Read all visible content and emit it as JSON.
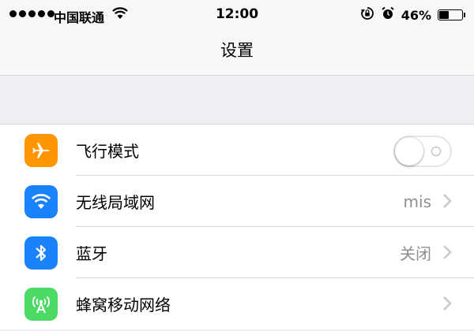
{
  "status_bar": {
    "carrier": "中国联通",
    "time": "12:00",
    "battery_percent": "46%",
    "battery_level": 0.46
  },
  "nav": {
    "title": "设置"
  },
  "settings": [
    {
      "label": "飞行模式",
      "icon": "airplane-icon",
      "icon_color": "#ff9500",
      "toggle": false
    },
    {
      "label": "无线局域网",
      "value": "mis",
      "icon": "wifi-icon",
      "icon_color": "#1a82fb"
    },
    {
      "label": "蓝牙",
      "value": "关闭",
      "icon": "bluetooth-icon",
      "icon_color": "#1a82fb"
    },
    {
      "label": "蜂窝移动网络",
      "value": "",
      "icon": "cellular-icon",
      "icon_color": "#4cd964"
    }
  ]
}
